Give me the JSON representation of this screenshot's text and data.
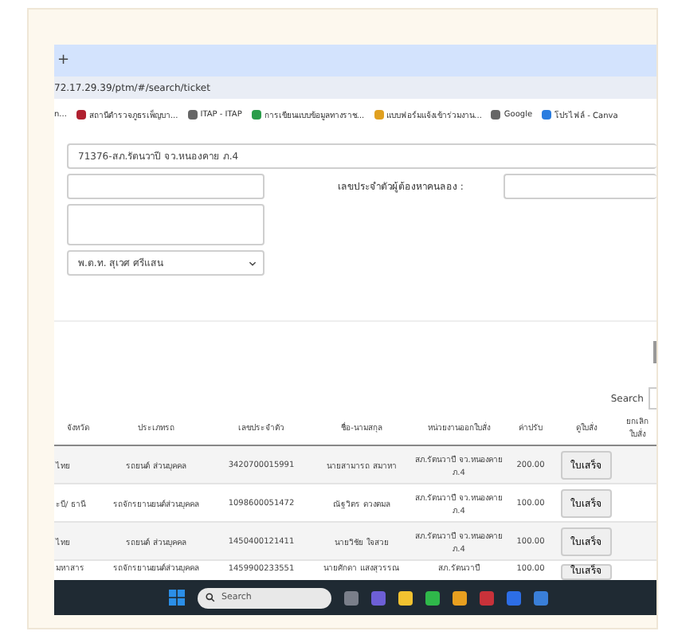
{
  "browser": {
    "new_tab": "+",
    "url": "72.17.29.39/ptm/#/search/ticket",
    "bookmarks": [
      {
        "label": "n..."
      },
      {
        "label": "สถานีตำรวจภูธรเพ็ญบา..."
      },
      {
        "label": "ITAP - ITAP"
      },
      {
        "label": "การเขียนแบบข้อมูลทางราช..."
      },
      {
        "label": "แบบฟอร์มแจ้งเข้าร่วมงาน..."
      },
      {
        "label": "Google"
      },
      {
        "label": "โปรไฟล์ - Canva"
      }
    ]
  },
  "form": {
    "station": "71376-สภ.รัตนวาปี จว.หนองคาย ภ.4",
    "id_label": "เลขประจำตัวผู้ต้องหาคนลอง :",
    "officer": "พ.ต.ท. สุเวศ ศรีแสน"
  },
  "search_label": "Search",
  "table": {
    "columns": [
      "จังหวัด",
      "ประเภทรถ",
      "เลขประจำตัว",
      "ชื่อ-นามสกุล",
      "หน่วยงานออกใบสั่ง",
      "ค่าปรับ",
      "ดูใบสั่ง",
      "ยกเลิก ใบสั่ง"
    ],
    "rows": [
      {
        "cells": [
          "ไทย",
          "รถยนต์ ส่วนบุคคล",
          "3420700015991",
          "นายสามารถ สมาหา",
          "สภ.รัตนวาปี จว.หนองคาย ภ.4",
          "200.00"
        ],
        "button": "ใบเสร็จ"
      },
      {
        "cells": [
          "ะบี/ ธานี",
          "รถจักรยานยนต์ส่วนบุคคล",
          "1098600051472",
          "ณัฐวิตร ดวงตมล",
          "สภ.รัตนวาปี จว.หนองคาย ภ.4",
          "100.00"
        ],
        "button": "ใบเสร็จ"
      },
      {
        "cells": [
          "ไทย",
          "รถยนต์ ส่วนบุคคล",
          "1450400121411",
          "นายวิชัย ใจสวย",
          "สภ.รัตนวาปี จว.หนองคาย ภ.4",
          "100.00"
        ],
        "button": "ใบเสร็จ"
      },
      {
        "cells": [
          "มหาสาร",
          "รถจักรยานยนต์ส่วนบุคคล",
          "1459900233551",
          "นายศักดา แสงสุวรรณ",
          "สภ.รัตนวาปี",
          "100.00"
        ],
        "button": "ใบเสร็จ"
      }
    ]
  },
  "taskbar": {
    "search_placeholder": "Search"
  }
}
